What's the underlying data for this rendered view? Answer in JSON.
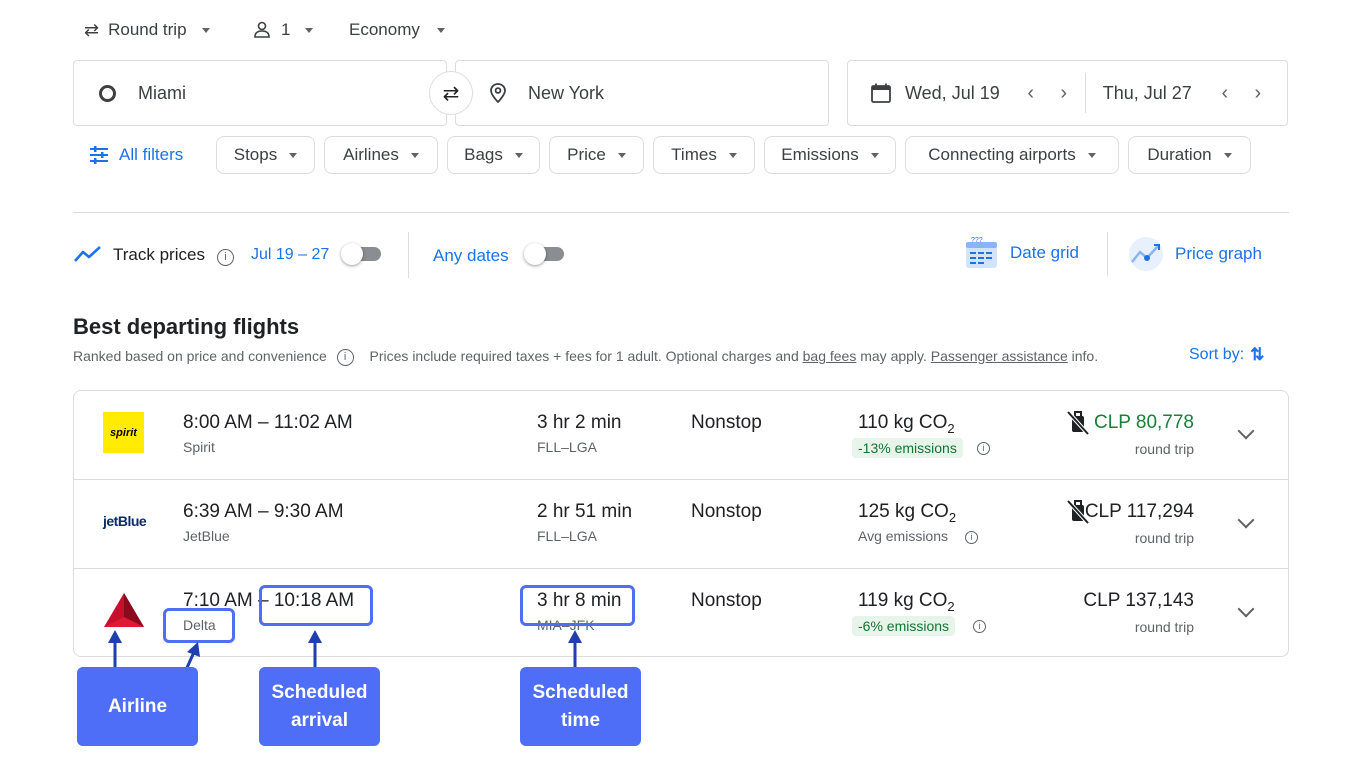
{
  "top": {
    "trip_type": "Round trip",
    "passengers": "1",
    "cabin": "Economy"
  },
  "search": {
    "origin": "Miami",
    "destination": "New York",
    "depart_date": "Wed, Jul 19",
    "return_date": "Thu, Jul 27"
  },
  "filters": {
    "all_filters": "All filters",
    "chips": [
      "Stops",
      "Airlines",
      "Bags",
      "Price",
      "Times",
      "Emissions",
      "Connecting airports",
      "Duration"
    ]
  },
  "tools": {
    "track_prices": "Track prices",
    "track_range": "Jul 19 – 27",
    "any_dates": "Any dates",
    "date_grid": "Date grid",
    "price_graph": "Price graph"
  },
  "section": {
    "title": "Best departing flights",
    "ranked": "Ranked based on price and convenience",
    "note_pre": "Prices include required taxes + fees for 1 adult. Optional charges and ",
    "bag_fees": "bag fees",
    "note_mid": " may apply. ",
    "passenger_assistance": "Passenger assistance",
    "note_post": " info.",
    "sort_by": "Sort by:"
  },
  "flights": [
    {
      "times": "8:00 AM – 11:02 AM",
      "airline": "Spirit",
      "logo_text": "spirit",
      "duration": "3 hr 2 min",
      "route": "FLL–LGA",
      "stops": "Nonstop",
      "co2": "110 kg CO",
      "co2_sub": "2",
      "emissions": "-13% emissions",
      "price": "CLP 80,778",
      "price_note": "round trip"
    },
    {
      "times": "6:39 AM – 9:30 AM",
      "airline": "JetBlue",
      "logo_text": "jetBlue",
      "duration": "2 hr 51 min",
      "route": "FLL–LGA",
      "stops": "Nonstop",
      "co2": "125 kg CO",
      "co2_sub": "2",
      "emissions": "Avg emissions",
      "price": "CLP 117,294",
      "price_note": "round trip"
    },
    {
      "depart": "7:10 AM",
      "arrive": "10:18 AM",
      "airline": "Delta",
      "duration": "3 hr 8 min",
      "route": "MIA–JFK",
      "stops": "Nonstop",
      "co2": "119 kg CO",
      "co2_sub": "2",
      "emissions": "-6% emissions",
      "price": "CLP 137,143",
      "price_note": "round trip"
    }
  ],
  "annotations": {
    "airline": "Airline",
    "arrival_1": "Scheduled",
    "arrival_2": "arrival",
    "time_1": "Scheduled",
    "time_2": "time",
    "color": "#4f6ef7"
  },
  "colors": {
    "accent_blue": "#1a73e8",
    "price_green": "#188038",
    "emissions_bg": "#e6f4ea"
  }
}
